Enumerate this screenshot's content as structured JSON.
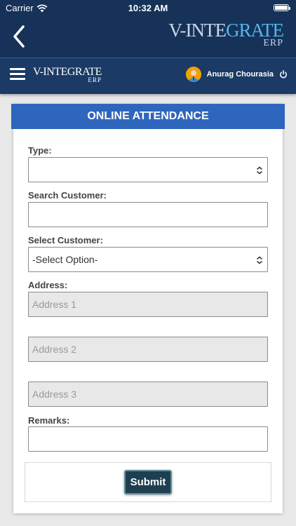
{
  "status_bar": {
    "carrier": "Carrier",
    "time": "10:32 AM"
  },
  "brand": {
    "name_prefix": "V-INTE",
    "name_highlight": "GRATE",
    "sub": "ERP"
  },
  "appbar": {
    "brand_name": "V-INTEGRATE",
    "brand_sub": "ERP",
    "user_name": "Anurag Chourasia"
  },
  "form": {
    "title": "ONLINE ATTENDANCE",
    "type_label": "Type:",
    "type_value": "",
    "search_label": "Search Customer:",
    "search_value": "",
    "select_label": "Select Customer:",
    "select_value": "-Select Option-",
    "address_label": "Address:",
    "address1_placeholder": "Address 1",
    "address2_placeholder": "Address 2",
    "address3_placeholder": "Address 3",
    "remarks_label": "Remarks:",
    "remarks_value": "",
    "submit_label": "Submit"
  },
  "colors": {
    "header_navy": "#163259",
    "appbar_navy": "#1b3a65",
    "card_header_blue": "#2f66bd",
    "submit_bg": "#1e3f4f",
    "brand_highlight": "#56b6ea"
  },
  "icons": [
    "wifi-icon",
    "battery-icon",
    "back-chevron-icon",
    "hamburger-menu-icon",
    "user-avatar-icon",
    "power-icon",
    "select-chevron-icon"
  ]
}
